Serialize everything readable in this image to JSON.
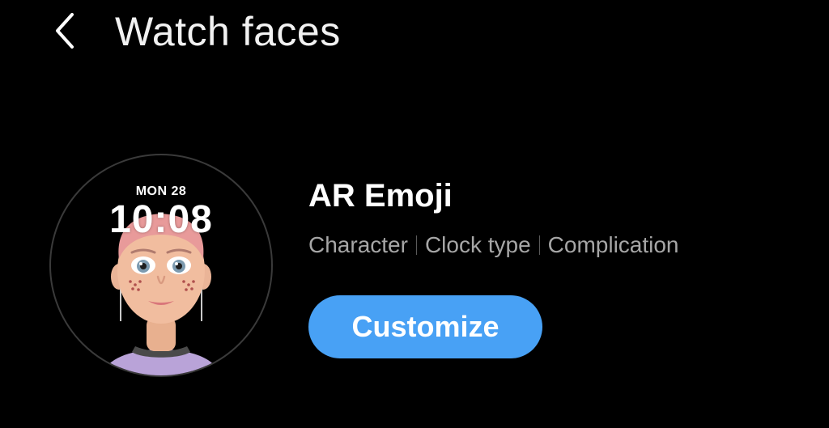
{
  "header": {
    "back_icon": "chevron-left-icon",
    "title": "Watch faces"
  },
  "watch_face": {
    "date": "MON 28",
    "time": "10:08",
    "name": "AR Emoji",
    "tags": [
      "Character",
      "Clock type",
      "Complication"
    ],
    "customize_label": "Customize"
  },
  "colors": {
    "background": "#000000",
    "accent_button": "#48a1f5",
    "secondary_text": "#a6a6a6",
    "watch_bezel": "#3a3a3a"
  }
}
